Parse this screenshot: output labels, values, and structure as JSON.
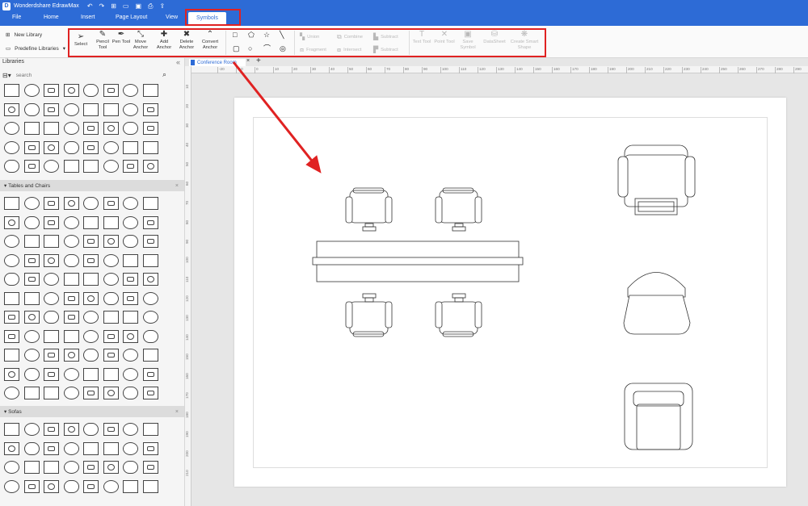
{
  "app": {
    "title": "Wonderdshare EdrawMax",
    "brand_color": "#2d6bd6",
    "highlight_color": "#e02222"
  },
  "menu": {
    "file": "File",
    "home": "Home",
    "insert": "Insert",
    "page_layout": "Page Layout",
    "view": "View",
    "symbols": "Symbols"
  },
  "ribbon": {
    "new_library": "New Library",
    "predefine_libraries": "Predefine Libraries",
    "tools": {
      "select": "Select",
      "pencil": "Pencil Tool",
      "pen": "Pen Tool",
      "move_anchor": "Move Anchor",
      "add_anchor": "Add Anchor",
      "delete_anchor": "Delete Anchor",
      "convert_anchor": "Convert Anchor"
    },
    "boolean": {
      "union": "Union",
      "combine": "Combine",
      "subtract1": "Subtract",
      "fragment": "Fragment",
      "intersect": "Intersect",
      "subtract2": "Subtract"
    },
    "symbol_tools": {
      "text_tool": "Text Tool",
      "point_tool": "Point Tool",
      "save_symbol": "Save Symbol",
      "datasheet": "DataSheet",
      "smart_shape": "Create Smart Shape"
    }
  },
  "left_panel": {
    "title": "Libraries",
    "search_placeholder": "search",
    "sections": {
      "tables_chairs": "Tables and Chairs",
      "sofas": "Sofas"
    }
  },
  "tab": {
    "name": "Conference Room"
  },
  "rulers": {
    "h": [
      "-20",
      "-10",
      "0",
      "10",
      "20",
      "30",
      "40",
      "50",
      "60",
      "70",
      "80",
      "90",
      "100",
      "110",
      "120",
      "130",
      "140",
      "150",
      "160",
      "170",
      "180",
      "190",
      "200",
      "210",
      "220",
      "230",
      "240",
      "250",
      "260",
      "270",
      "280",
      "290",
      "300"
    ],
    "v": [
      "10",
      "20",
      "30",
      "40",
      "50",
      "60",
      "70",
      "80",
      "90",
      "100",
      "110",
      "120",
      "130",
      "140",
      "150",
      "160",
      "170",
      "180",
      "190",
      "200",
      "210"
    ]
  }
}
